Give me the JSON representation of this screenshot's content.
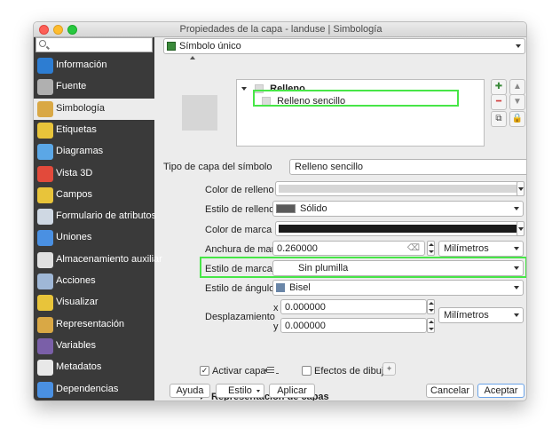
{
  "window": {
    "title": "Propiedades de la capa - landuse | Simbología"
  },
  "sidebar": {
    "search_placeholder": "",
    "items": [
      {
        "label": "Información",
        "icon": "info-icon",
        "color": "#2d7dd2",
        "active": false
      },
      {
        "label": "Fuente",
        "icon": "wrench-icon",
        "color": "#b0b0b0",
        "active": false
      },
      {
        "label": "Simbología",
        "icon": "paintbrush-icon",
        "color": "#d9a845",
        "active": true
      },
      {
        "label": "Etiquetas",
        "icon": "abc-label-icon",
        "color": "#e8c43a",
        "active": false
      },
      {
        "label": "Diagramas",
        "icon": "diagram-icon",
        "color": "#5ba7e6",
        "active": false
      },
      {
        "label": "Vista 3D",
        "icon": "cube-3d-icon",
        "color": "#e24a3b",
        "active": false
      },
      {
        "label": "Campos",
        "icon": "fields-icon",
        "color": "#e8c43a",
        "active": false
      },
      {
        "label": "Formulario de atributos",
        "icon": "form-icon",
        "color": "#cfd8e3",
        "active": false
      },
      {
        "label": "Uniones",
        "icon": "join-icon",
        "color": "#4a90e2",
        "active": false
      },
      {
        "label": "Almacenamiento auxiliar",
        "icon": "storage-icon",
        "color": "#e0e0e0",
        "active": false
      },
      {
        "label": "Acciones",
        "icon": "gear-icon",
        "color": "#9fb7d6",
        "active": false
      },
      {
        "label": "Visualizar",
        "icon": "speech-bubble-icon",
        "color": "#e8c43a",
        "active": false
      },
      {
        "label": "Representación",
        "icon": "paintbrush-render-icon",
        "color": "#d9a845",
        "active": false
      },
      {
        "label": "Variables",
        "icon": "variables-icon",
        "color": "#7a5fa8",
        "active": false
      },
      {
        "label": "Metadatos",
        "icon": "metadata-icon",
        "color": "#e8e8e8",
        "active": false
      },
      {
        "label": "Dependencias",
        "icon": "dependencies-icon",
        "color": "#4a90e2",
        "active": false
      }
    ]
  },
  "renderer": {
    "selected": "Símbolo único"
  },
  "symbol_tree": {
    "parent": "Relleno",
    "child": "Relleno sencillo"
  },
  "symbol_layer_type": {
    "label": "Tipo de capa del símbolo",
    "value": "Relleno sencillo"
  },
  "properties": {
    "fill_color": {
      "label": "Color de relleno",
      "color": "#d6d6d6"
    },
    "fill_style": {
      "label": "Estilo de relleno",
      "value": "Sólido",
      "swatch": "#5a5a5a"
    },
    "stroke_color": {
      "label": "Color de marca",
      "color": "#1a1a1a"
    },
    "stroke_width": {
      "label": "Anchura de marca",
      "value": "0.260000",
      "unit": "Milímetros"
    },
    "stroke_style": {
      "label": "Estilo de marca",
      "value": "Sin plumilla"
    },
    "join_style": {
      "label": "Estilo de ángulos",
      "value": "Bisel",
      "swatch": "#6a86a8"
    },
    "offset": {
      "label": "Desplazamiento",
      "x_label": "x",
      "x_value": "0.000000",
      "y_label": "y",
      "y_value": "0.000000",
      "unit": "Milímetros"
    }
  },
  "options": {
    "enable_layer": {
      "label": "Activar capa",
      "checked": true,
      "mark": "✓"
    },
    "draw_effects": {
      "label": "Efectos de dibujo",
      "checked": false
    }
  },
  "layer_rendering": {
    "label": "Representación de capas"
  },
  "buttons": {
    "help": "Ayuda",
    "style": "Estilo",
    "apply": "Aplicar",
    "cancel": "Cancelar",
    "accept": "Aceptar"
  }
}
